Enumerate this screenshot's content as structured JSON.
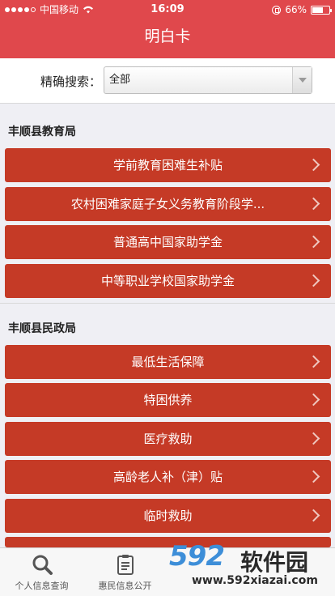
{
  "status_bar": {
    "carrier": "中国移动",
    "time": "16:09",
    "battery": "66%",
    "battery_level": 0.66
  },
  "header": {
    "title": "明白卡"
  },
  "search": {
    "label": "精确搜索：",
    "selected": "全部"
  },
  "sections": [
    {
      "title": "丰顺县教育局",
      "items": [
        "学前教育困难生补贴",
        "农村困难家庭子女义务教育阶段学...",
        "普通高中国家助学金",
        "中等职业学校国家助学金"
      ]
    },
    {
      "title": "丰顺县民政局",
      "items": [
        "最低生活保障",
        "特困供养",
        "医疗救助",
        "高龄老人补（津）贴",
        "临时救助"
      ]
    }
  ],
  "tabbar": {
    "tabs": [
      {
        "label": "个人信息查询",
        "icon": "search-icon"
      },
      {
        "label": "惠民信息公开",
        "icon": "clipboard-icon"
      }
    ]
  },
  "watermark": {
    "brand_number": "592",
    "brand_text": "软件园",
    "url": "www.592xiazai.com"
  }
}
